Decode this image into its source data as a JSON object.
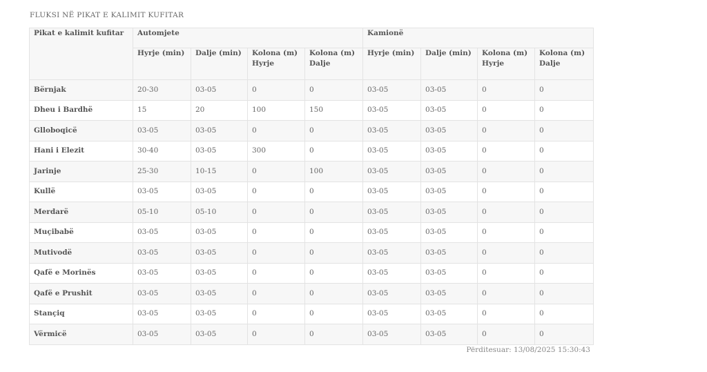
{
  "title": "FLUKSI NË PIKAT E KALIMIT KUFITAR",
  "table": {
    "first_col_header": "Pikat e kalimit kufitar",
    "groups": [
      "Automjete",
      "Kamionë"
    ],
    "sub_headers": [
      [
        "Hyrje (min)"
      ],
      [
        "Dalje (min)"
      ],
      [
        "Kolona (m)",
        "Hyrje"
      ],
      [
        "Kolona (m)",
        "Dalje"
      ],
      [
        "Hyrje (min)"
      ],
      [
        "Dalje (min)"
      ],
      [
        "Kolona (m)",
        "Hyrje"
      ],
      [
        "Kolona (m)",
        "Dalje"
      ]
    ],
    "rows": [
      {
        "name": "Bërnjak",
        "values": [
          "20-30",
          "03-05",
          "0",
          "0",
          "03-05",
          "03-05",
          "0",
          "0"
        ]
      },
      {
        "name": "Dheu i Bardhë",
        "values": [
          "15",
          "20",
          "100",
          "150",
          "03-05",
          "03-05",
          "0",
          "0"
        ]
      },
      {
        "name": "Glloboqicë",
        "values": [
          "03-05",
          "03-05",
          "0",
          "0",
          "03-05",
          "03-05",
          "0",
          "0"
        ]
      },
      {
        "name": "Hani i Elezit",
        "values": [
          "30-40",
          "03-05",
          "300",
          "0",
          "03-05",
          "03-05",
          "0",
          "0"
        ]
      },
      {
        "name": "Jarinje",
        "values": [
          "25-30",
          "10-15",
          "0",
          "100",
          "03-05",
          "03-05",
          "0",
          "0"
        ]
      },
      {
        "name": "Kullë",
        "values": [
          "03-05",
          "03-05",
          "0",
          "0",
          "03-05",
          "03-05",
          "0",
          "0"
        ]
      },
      {
        "name": "Merdarë",
        "values": [
          "05-10",
          "05-10",
          "0",
          "0",
          "03-05",
          "03-05",
          "0",
          "0"
        ]
      },
      {
        "name": "Muçibabë",
        "values": [
          "03-05",
          "03-05",
          "0",
          "0",
          "03-05",
          "03-05",
          "0",
          "0"
        ]
      },
      {
        "name": "Mutivodë",
        "values": [
          "03-05",
          "03-05",
          "0",
          "0",
          "03-05",
          "03-05",
          "0",
          "0"
        ]
      },
      {
        "name": "Qafë e Morinës",
        "values": [
          "03-05",
          "03-05",
          "0",
          "0",
          "03-05",
          "03-05",
          "0",
          "0"
        ]
      },
      {
        "name": "Qafë e Prushit",
        "values": [
          "03-05",
          "03-05",
          "0",
          "0",
          "03-05",
          "03-05",
          "0",
          "0"
        ]
      },
      {
        "name": "Stançiq",
        "values": [
          "03-05",
          "03-05",
          "0",
          "0",
          "03-05",
          "03-05",
          "0",
          "0"
        ]
      },
      {
        "name": "Vërmicë",
        "values": [
          "03-05",
          "03-05",
          "0",
          "0",
          "03-05",
          "03-05",
          "0",
          "0"
        ]
      }
    ]
  },
  "updated": "Përditesuar: 13/08/2025 15:30:43"
}
